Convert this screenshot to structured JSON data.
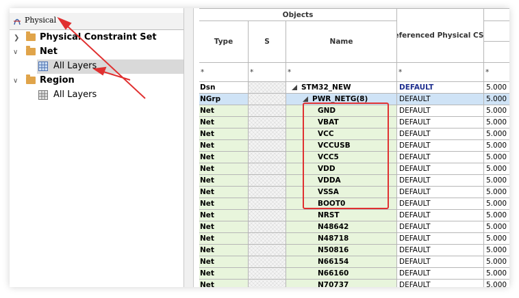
{
  "left_panel": {
    "tab_label": "Physical",
    "tree": [
      {
        "label": "Physical Constraint Set",
        "expanded": false
      },
      {
        "label": "Net",
        "expanded": true,
        "child": "All Layers"
      },
      {
        "label": "Region",
        "expanded": true,
        "child": "All Layers"
      }
    ]
  },
  "grid": {
    "group_header": "Objects",
    "columns": [
      "Type",
      "S",
      "Name",
      "Referenced Physical CSet"
    ],
    "filter": "*",
    "rows": [
      {
        "type": "Dsn",
        "name": "STM32_NEW",
        "ref": "DEFAULT",
        "val": "5.000"
      },
      {
        "type": "NGrp",
        "name": "PWR_NETG(8)",
        "ref": "DEFAULT",
        "val": "5.000"
      },
      {
        "type": "Net",
        "name": "GND",
        "ref": "DEFAULT",
        "val": "5.000"
      },
      {
        "type": "Net",
        "name": "VBAT",
        "ref": "DEFAULT",
        "val": "5.000"
      },
      {
        "type": "Net",
        "name": "VCC",
        "ref": "DEFAULT",
        "val": "5.000"
      },
      {
        "type": "Net",
        "name": "VCCUSB",
        "ref": "DEFAULT",
        "val": "5.000"
      },
      {
        "type": "Net",
        "name": "VCC5",
        "ref": "DEFAULT",
        "val": "5.000"
      },
      {
        "type": "Net",
        "name": "VDD",
        "ref": "DEFAULT",
        "val": "5.000"
      },
      {
        "type": "Net",
        "name": "VDDA",
        "ref": "DEFAULT",
        "val": "5.000"
      },
      {
        "type": "Net",
        "name": "VSSA",
        "ref": "DEFAULT",
        "val": "5.000"
      },
      {
        "type": "Net",
        "name": "BOOT0",
        "ref": "DEFAULT",
        "val": "5.000"
      },
      {
        "type": "Net",
        "name": "NRST",
        "ref": "DEFAULT",
        "val": "5.000"
      },
      {
        "type": "Net",
        "name": "N48642",
        "ref": "DEFAULT",
        "val": "5.000"
      },
      {
        "type": "Net",
        "name": "N48718",
        "ref": "DEFAULT",
        "val": "5.000"
      },
      {
        "type": "Net",
        "name": "N50816",
        "ref": "DEFAULT",
        "val": "5.000"
      },
      {
        "type": "Net",
        "name": "N66154",
        "ref": "DEFAULT",
        "val": "5.000"
      },
      {
        "type": "Net",
        "name": "N66160",
        "ref": "DEFAULT",
        "val": "5.000"
      },
      {
        "type": "Net",
        "name": "N70737",
        "ref": "DEFAULT",
        "val": "5.000"
      }
    ]
  },
  "colors": {
    "annotation_red": "#e03030",
    "ngrp_row": "#cfe3f6",
    "net_row": "#e8f5dc",
    "dsn_ref_text": "#1f2f8f"
  }
}
